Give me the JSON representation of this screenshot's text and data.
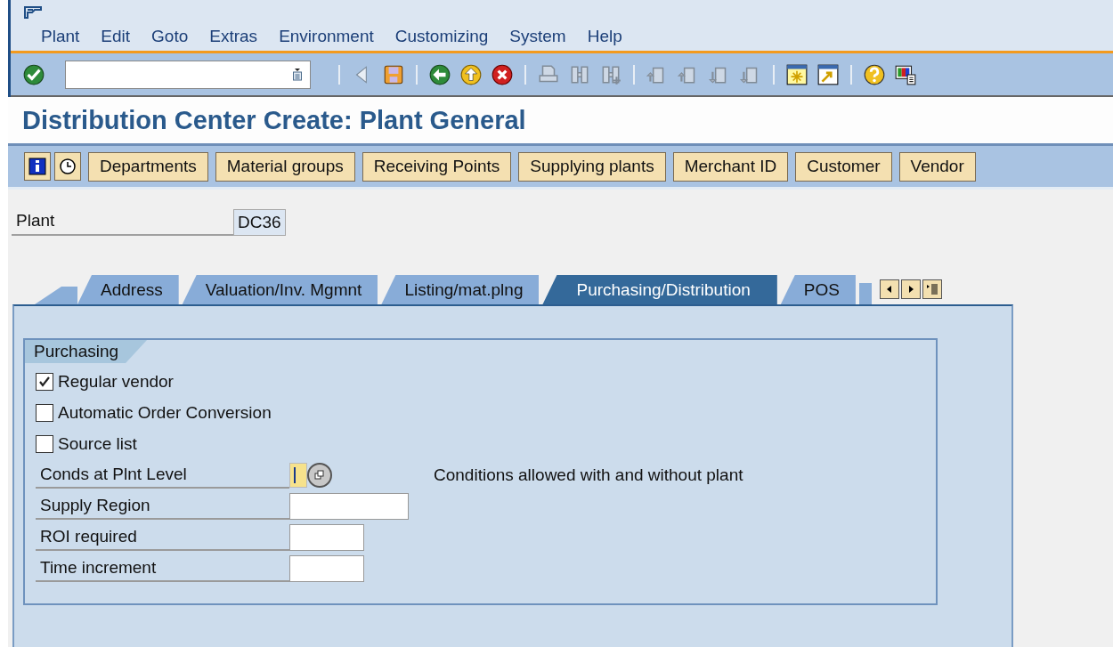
{
  "window": {
    "title": "Distribution Center Create: Plant General"
  },
  "menu": [
    "Plant",
    "Edit",
    "Goto",
    "Extras",
    "Environment",
    "Customizing",
    "System",
    "Help"
  ],
  "toolbar": {
    "groups": [
      [
        {
          "kind": "enter",
          "disabled": false
        }
      ],
      [
        {
          "kind": "back-small",
          "disabled": false
        },
        {
          "kind": "save",
          "disabled": false
        }
      ],
      [
        {
          "kind": "back",
          "disabled": false
        },
        {
          "kind": "exit",
          "disabled": false
        },
        {
          "kind": "cancel",
          "disabled": false
        }
      ],
      [
        {
          "kind": "print",
          "disabled": true
        },
        {
          "kind": "find",
          "disabled": true
        },
        {
          "kind": "find-next",
          "disabled": true
        }
      ],
      [
        {
          "kind": "first-page",
          "disabled": true
        },
        {
          "kind": "previous-page",
          "disabled": true
        },
        {
          "kind": "next-page",
          "disabled": true
        },
        {
          "kind": "last-page",
          "disabled": true
        }
      ],
      [
        {
          "kind": "new-session",
          "disabled": false
        },
        {
          "kind": "shortcut",
          "disabled": false
        }
      ],
      [
        {
          "kind": "help",
          "disabled": false
        },
        {
          "kind": "layout",
          "disabled": false
        }
      ]
    ]
  },
  "app_buttons": [
    "Departments",
    "Material groups",
    "Receiving Points",
    "Supplying plants",
    "Merchant ID",
    "Customer",
    "Vendor"
  ],
  "plant": {
    "label": "Plant",
    "value": "DC36"
  },
  "tabs": [
    {
      "label": "Address",
      "selected": false
    },
    {
      "label": "Valuation/Inv. Mgmnt",
      "selected": false
    },
    {
      "label": "Listing/mat.plng",
      "selected": false
    },
    {
      "label": "Purchasing/Distribution",
      "selected": true
    },
    {
      "label": "POS",
      "selected": false
    }
  ],
  "group": {
    "title": "Purchasing",
    "items": [
      {
        "kind": "checkbox",
        "label": "Regular vendor",
        "checked": true
      },
      {
        "kind": "checkbox",
        "label": "Automatic Order Conversion",
        "checked": false
      },
      {
        "kind": "checkbox",
        "label": "Source list",
        "checked": false
      },
      {
        "kind": "select",
        "label": "Conds at Plnt Level",
        "description": "Conditions allowed with and without plant"
      },
      {
        "kind": "field-long",
        "label": "Supply Region"
      },
      {
        "kind": "field-short",
        "label": "ROI required"
      },
      {
        "kind": "field-short",
        "label": "Time increment"
      }
    ]
  }
}
